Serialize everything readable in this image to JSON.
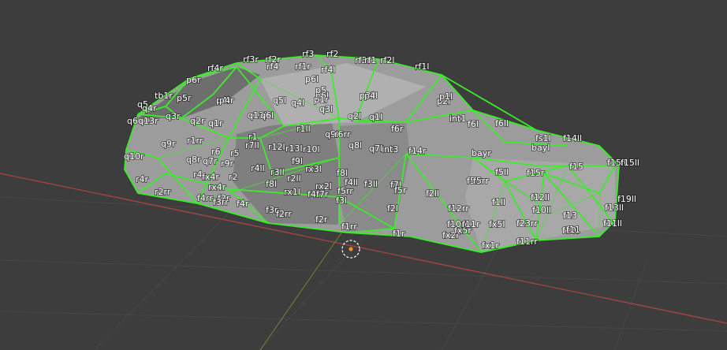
{
  "app": "3D viewport",
  "colors": {
    "background": "#3d3d3d",
    "grid": "#474747",
    "axis_x": "#a84545",
    "axis_y": "#7a9a38",
    "mesh_body": "#9c9c9c",
    "mesh_dark": "#6e6e6e",
    "wire": "#3dea2c",
    "label": "#ffffff",
    "origin_ring": "#ffffff",
    "origin_dot": "#f28c1e"
  },
  "vertex_labels": [
    "rf3",
    "rf2",
    "rf3l",
    "rf1",
    "rf2l",
    "rf3r",
    "rf2r",
    "rf4r",
    "rf4",
    "rf1r",
    "rf4l",
    "rf1l",
    "p6r",
    "p6l",
    "p5",
    "p6l",
    "tb1r",
    "p5r",
    "p4r",
    "p4r",
    "q5",
    "q4r",
    "q3r",
    "q5l",
    "q4l",
    "p1r",
    "q3l",
    "p3l",
    "p4l",
    "p2l",
    "p1l",
    "q6q13r",
    "q2r",
    "q1r",
    "q13l",
    "q6l",
    "q2l",
    "q1l",
    "int1",
    "f6l",
    "f6ll",
    "f6r",
    "r1rr",
    "q9r",
    "r1",
    "r7ll",
    "r12l",
    "r13l",
    "r10l",
    "r1ll",
    "q9l",
    "r6rr",
    "q8l",
    "q7l",
    "int3",
    "f14r",
    "f14ll",
    "fs1l",
    "bayl",
    "bayr",
    "q10r",
    "q7r",
    "r9r",
    "q8r",
    "r6",
    "r5",
    "r4ll",
    "r3ll",
    "f9l",
    "rx3l",
    "f8l",
    "f5ll",
    "f15r",
    "f15",
    "f15ll",
    "f15ll",
    "r4r",
    "r2rr",
    "r4",
    "fx4r",
    "rx4r",
    "r2",
    "f8l",
    "rx1l",
    "r2ll",
    "rx2l",
    "f4ll",
    "f3ll",
    "f7l",
    "f5r",
    "f2ll",
    "f5rr",
    "f5rr",
    "f4rr",
    "f2r",
    "f4r",
    "f3rr",
    "f3l",
    "f5rr",
    "f4f7r",
    "f2l",
    "f12rr",
    "f1ll",
    "f12ll",
    "f10ll",
    "f19ll",
    "f13ll",
    "f3r",
    "f2rr",
    "f2r",
    "f1rr",
    "f1r",
    "fx2r",
    "fx5r",
    "f10rr",
    "f11r",
    "fx5l",
    "f23rr",
    "f13",
    "f11ll",
    "f10l",
    "f11",
    "f11rr",
    "fx1r"
  ]
}
